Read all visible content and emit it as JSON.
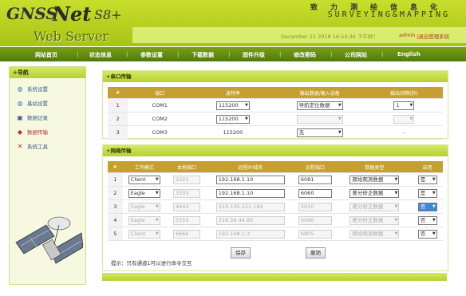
{
  "header": {
    "logo_text": "GNSS Net S8+",
    "subtitle": "Web Server",
    "brand_cn": "致力测绘信息化",
    "brand_en": "SURVEYING&MAPPING",
    "datetime": "December 21 2018 16:54:36  下午好！",
    "user": "admin",
    "logout": "|退出管理系统"
  },
  "nav": {
    "items": [
      "网站首页",
      "状态信息",
      "参数设置",
      "下载数据",
      "固件升级",
      "修改密码",
      "公司网站",
      "English"
    ],
    "separator": "|"
  },
  "sidebar": {
    "title": "+导航",
    "items": [
      {
        "label": "系统设置",
        "icon": "globe-icon"
      },
      {
        "label": "基站设置",
        "icon": "globe-icon"
      },
      {
        "label": "数据记录",
        "icon": "save-icon"
      },
      {
        "label": "数据传输",
        "icon": "transfer-icon"
      },
      {
        "label": "系统工具",
        "icon": "tools-icon"
      }
    ]
  },
  "serial_panel": {
    "title": "+串口传输",
    "columns": [
      "#",
      "端口",
      "波特率",
      "输出数据/输入设备",
      "输出间隔(秒)"
    ],
    "rows": [
      {
        "num": "1",
        "port": "COM1",
        "baud": "115200",
        "data": "导航定位数据",
        "interval": "1"
      },
      {
        "num": "2",
        "port": "COM2",
        "baud": "115200",
        "data": "",
        "interval": ""
      },
      {
        "num": "3",
        "port": "COM3",
        "baud": "115200",
        "data": "无",
        "interval": "-"
      }
    ]
  },
  "net_panel": {
    "title": "+网络传输",
    "columns": [
      "#",
      "工作模式",
      "本地端口",
      "远程IP/域名",
      "远程端口",
      "数据类型",
      "启用"
    ],
    "rows": [
      {
        "num": "1",
        "mode": "Client",
        "local": "2222",
        "ip": "192.168.1.10",
        "remote": "6081",
        "dtype": "原始观测数据",
        "enable": "是"
      },
      {
        "num": "2",
        "mode": "Eagle",
        "local": "3333",
        "ip": "192.168.1.10",
        "remote": "6060",
        "dtype": "差分修正数据",
        "enable": "是"
      },
      {
        "num": "3",
        "mode": "Eagle",
        "local": "4444",
        "ip": "219.135.151.184",
        "remote": "2010",
        "dtype": "差分修正数据",
        "enable": "否"
      },
      {
        "num": "4",
        "mode": "Eagle",
        "local": "5555",
        "ip": "218.56.44.85",
        "remote": "6060",
        "dtype": "差分修正数据",
        "enable": "否"
      },
      {
        "num": "5",
        "mode": "Client",
        "local": "6666",
        "ip": "192.168.1.3",
        "remote": "6805",
        "dtype": "原始观测数据",
        "enable": "否"
      }
    ],
    "save_label": "保存",
    "cancel_label": "撤销",
    "hint": "提示：只有通道1可以进行命令交互"
  }
}
